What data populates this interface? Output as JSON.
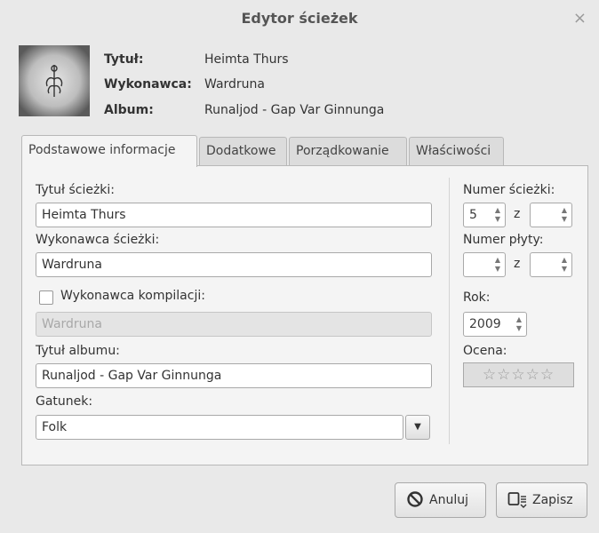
{
  "window": {
    "title": "Edytor ścieżek",
    "close_glyph": "×"
  },
  "meta": {
    "title_label": "Tytuł:",
    "title_value": "Heimta Thurs",
    "artist_label": "Wykonawca:",
    "artist_value": "Wardruna",
    "album_label": "Album:",
    "album_value": "Runaljod - Gap Var Ginnunga"
  },
  "tabs": [
    {
      "label": "Podstawowe informacje"
    },
    {
      "label": "Dodatkowe"
    },
    {
      "label": "Porządkowanie"
    },
    {
      "label": "Właściwości"
    }
  ],
  "form": {
    "track_title_label": "Tytuł ścieżki:",
    "track_title_value": "Heimta Thurs",
    "track_artist_label": "Wykonawca ścieżki:",
    "track_artist_value": "Wardruna",
    "compilation_label": "Wykonawca kompilacji:",
    "compilation_value": "Wardruna",
    "album_title_label": "Tytuł albumu:",
    "album_title_value": "Runaljod - Gap Var Ginnunga",
    "genre_label": "Gatunek:",
    "genre_value": "Folk"
  },
  "side": {
    "track_number_label": "Numer ścieżki:",
    "track_number_value": "5",
    "of": "z",
    "disc_number_label": "Numer płyty:",
    "year_label": "Rok:",
    "year_value": "2009",
    "rating_label": "Ocena:",
    "rating_stars": "☆☆☆☆☆",
    "rating_value": 0
  },
  "buttons": {
    "cancel": "Anuluj",
    "save": "Zapisz"
  }
}
